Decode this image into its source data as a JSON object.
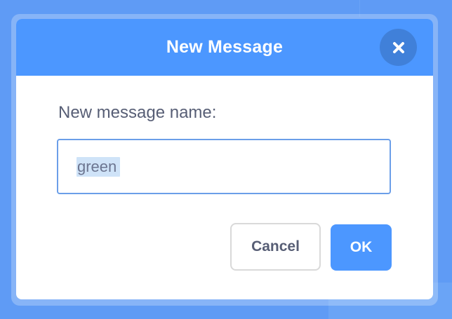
{
  "dialog": {
    "title": "New Message",
    "close_icon": "close-icon",
    "prompt": "New message name:",
    "input": {
      "value": "green",
      "placeholder": ""
    },
    "buttons": {
      "cancel": "Cancel",
      "ok": "OK"
    }
  },
  "colors": {
    "header": "#4c97ff",
    "backdrop": "#5f9bf5",
    "text": "#575e75",
    "primary_button": "#4c97ff",
    "selection": "#cfe3f8"
  }
}
